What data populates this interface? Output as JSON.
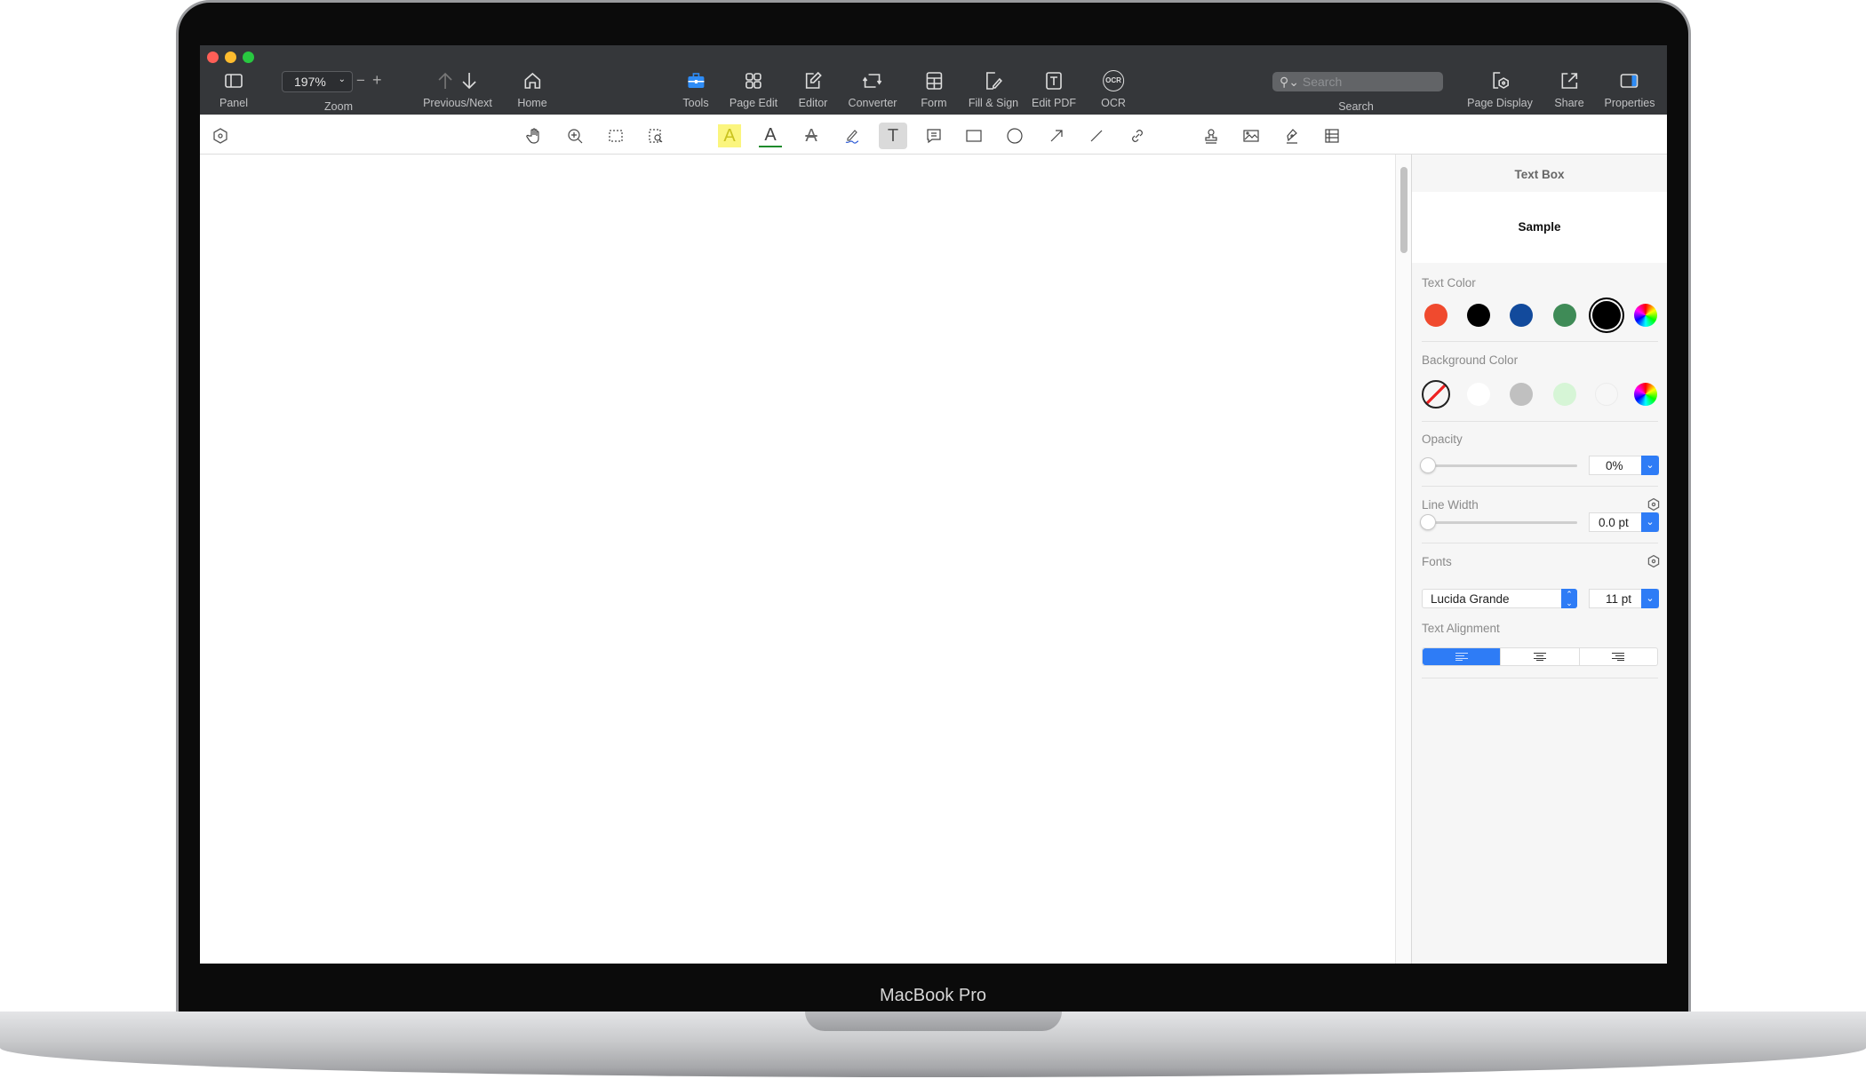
{
  "device": {
    "label": "MacBook Pro"
  },
  "toolbar": {
    "zoom_value": "197%",
    "search_placeholder": "Search",
    "items": [
      {
        "label": "Panel",
        "icon": "sidebar-icon"
      },
      {
        "label": "Zoom",
        "icon": "zoom-stepper"
      },
      {
        "label": "Previous/Next",
        "icon": "arrow-up-down-icon"
      },
      {
        "label": "Home",
        "icon": "home-icon"
      },
      {
        "label": "Tools",
        "icon": "toolbox-icon"
      },
      {
        "label": "Page Edit",
        "icon": "grid-icon"
      },
      {
        "label": "Editor",
        "icon": "edit-icon"
      },
      {
        "label": "Converter",
        "icon": "convert-icon"
      },
      {
        "label": "Form",
        "icon": "form-icon"
      },
      {
        "label": "Fill & Sign",
        "icon": "fill-sign-icon"
      },
      {
        "label": "Edit PDF",
        "icon": "text-box-icon"
      },
      {
        "label": "OCR",
        "icon": "ocr-icon"
      },
      {
        "label": "Search",
        "icon": "search-icon"
      },
      {
        "label": "Page Display",
        "icon": "page-display-icon"
      },
      {
        "label": "Share",
        "icon": "share-icon"
      },
      {
        "label": "Properties",
        "icon": "properties-icon"
      }
    ],
    "ocr_glyph": "OCR",
    "highlight_glyph": "A",
    "text_glyph": "T"
  },
  "panel": {
    "title": "Text Box",
    "sample": "Sample",
    "text_color_label": "Text Color",
    "text_colors": [
      "#f04a2e",
      "#000000",
      "#124a9c",
      "#3f8b57",
      "#000000"
    ],
    "background_color_label": "Background Color",
    "background_colors": [
      "none",
      "#ffffff",
      "#c0c0c0",
      "#d6f5d6",
      "#f7f7f7"
    ],
    "opacity_label": "Opacity",
    "opacity_value": "0%",
    "opacity": 0,
    "line_width_label": "Line Width",
    "line_width_value": "0.0 pt",
    "line_width": 0,
    "fonts_label": "Fonts",
    "font_name": "Lucida Grande",
    "font_size": "11 pt",
    "alignment_label": "Text Alignment",
    "alignment_selected": "left"
  },
  "colors": {
    "accent": "#2e7cf6",
    "toolbar_bg": "#35373a"
  }
}
